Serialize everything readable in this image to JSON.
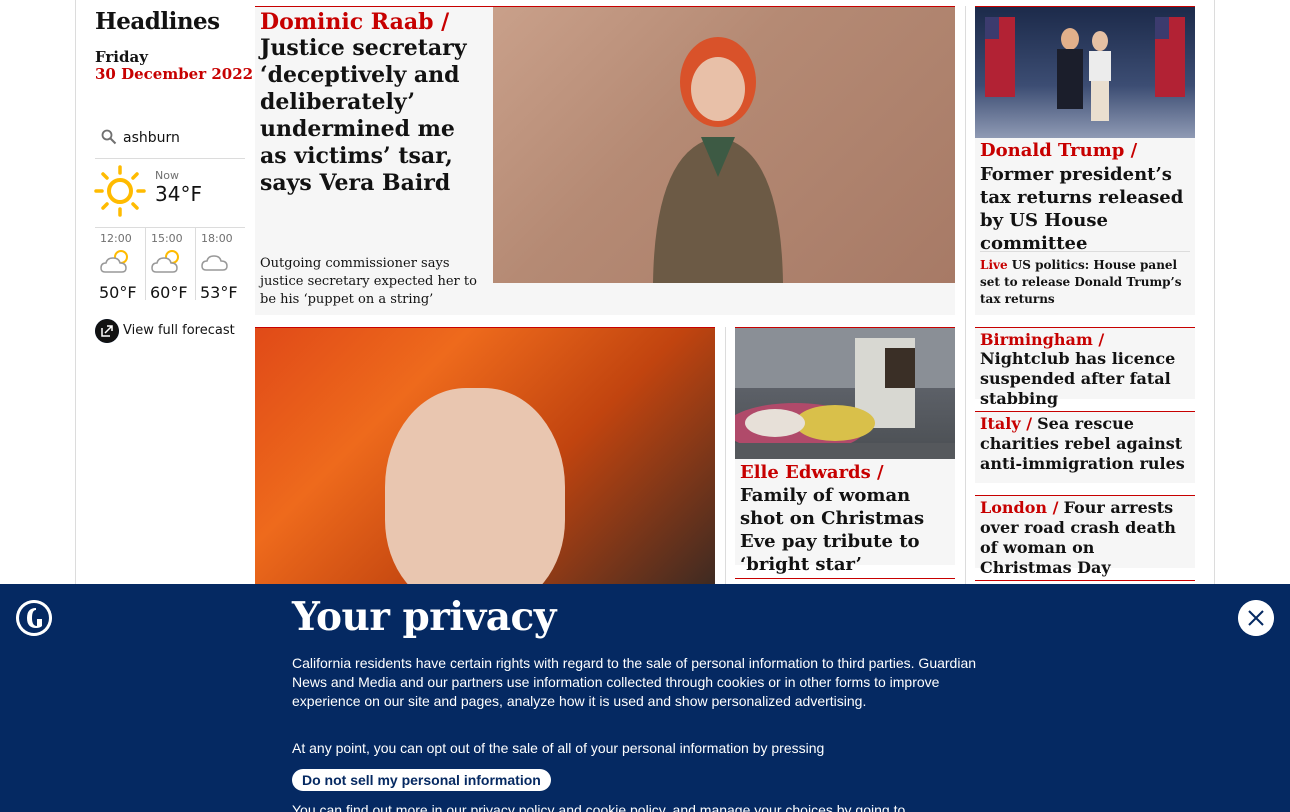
{
  "sidebar": {
    "title": "Headlines",
    "day": "Friday",
    "date": "30 December 2022",
    "location": "ashburn",
    "now_label": "Now",
    "now_temp": "34°F",
    "forecast": [
      {
        "time": "12:00",
        "temp": "50°F",
        "icon": "partly-sunny-icon"
      },
      {
        "time": "15:00",
        "temp": "60°F",
        "icon": "partly-sunny-icon"
      },
      {
        "time": "18:00",
        "temp": "53°F",
        "icon": "cloudy-night-icon"
      }
    ],
    "full_forecast": "View full forecast"
  },
  "main_story": {
    "kicker": "Dominic Raab /",
    "headline": "Justice secretary ‘deceptively and deliberately’ undermined me as victims’ tsar, says Vera Baird",
    "standfirst": "Outgoing commissioner says justice secretary expected her to be his ‘puppet on a string’"
  },
  "trump_story": {
    "kicker": "Donald Trump /",
    "headline": "Former president’s tax returns released by US House committee",
    "live_label": "Live",
    "live_text": "US politics: House panel set to release Donald Trump’s tax returns"
  },
  "small_stories": [
    {
      "kicker": "Birmingham /",
      "headline": "Nightclub has licence suspended after fatal stabbing"
    },
    {
      "kicker": "Italy /",
      "headline": "Sea rescue charities rebel against anti-immigration rules"
    },
    {
      "kicker": "London /",
      "headline": "Four arrests over road crash death of woman on Christmas Day"
    }
  ],
  "elle_story": {
    "kicker": "Elle Edwards /",
    "headline": "Family of woman shot on Christmas Eve pay tribute to ‘bright star’"
  },
  "privacy": {
    "title": "Your privacy",
    "para1": "California residents have certain rights with regard to the sale of personal information to third parties. Guardian News and Media and our partners use information collected through cookies or in other forms to improve experience on our site and pages, analyze how it is used and show personalized advertising.",
    "para2": "At any point, you can opt out of the sale of all of your personal information by pressing",
    "button": "Do not sell my personal information",
    "para3": "You can find out more in our privacy policy and cookie policy, and manage your choices by going to"
  },
  "colors": {
    "accent": "#c70000",
    "brand": "#052962",
    "card_bg": "#f6f6f6"
  }
}
